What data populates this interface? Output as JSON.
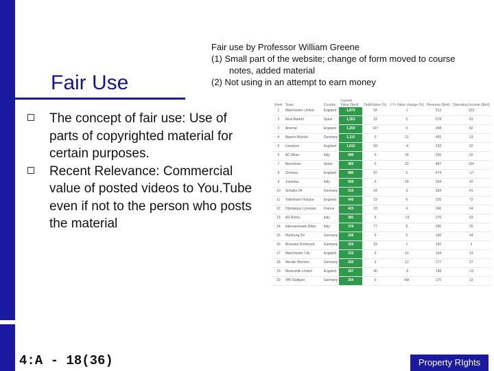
{
  "slide": {
    "title": "Fair Use",
    "note": {
      "line1": "Fair use by Professor William Greene",
      "line2": "(1)  Small part of the website; change of form moved to course",
      "line3": "notes, added material",
      "line4": "(2)  Not using in an attempt to earn money"
    },
    "bullets": [
      "The concept of fair use: Use of parts of copyrighted material for certain purposes.",
      "Recent Relevance: Commercial value of posted videos to You.Tube even if not to the person who posts the material"
    ],
    "footer_id": "4:A - 18(36)",
    "footer_label": "Property RIghts"
  },
  "table": {
    "headers": [
      "Rank",
      "Team",
      "Country",
      "Current Value ($mil)",
      "Debt/Value (%)",
      "1-Yr Value change (%)",
      "Revenue ($mil)",
      "Operating Income ($mil)"
    ],
    "rows": [
      [
        "1",
        "Manchester United",
        "England",
        "1,870",
        "54",
        "-1",
        "512",
        "103"
      ],
      [
        "2",
        "Real Madrid",
        "Spain",
        "1,353",
        "23",
        "5",
        "578",
        "81"
      ],
      [
        "3",
        "Arsenal",
        "England",
        "1,200",
        "107",
        "0",
        "348",
        "82"
      ],
      [
        "4",
        "Bayern Munich",
        "Germany",
        "1,110",
        "0",
        "21",
        "465",
        "53"
      ],
      [
        "5",
        "Liverpool",
        "England",
        "1,010",
        "59",
        "-4",
        "232",
        "52"
      ],
      [
        "6",
        "AC Milan",
        "Italy",
        "990",
        "0",
        "24",
        "330",
        "52"
      ],
      [
        "7",
        "Barcelona",
        "Spain",
        "960",
        "0",
        "22",
        "487",
        "104"
      ],
      [
        "8",
        "Chelsea",
        "England",
        "880",
        "87",
        "5",
        "474",
        "-17"
      ],
      [
        "9",
        "Juventus",
        "Italy",
        "659",
        "0",
        "18",
        "264",
        "42"
      ],
      [
        "10",
        "Schalke 04",
        "Germany",
        "516",
        "34",
        "9",
        "334",
        "41"
      ],
      [
        "11",
        "Tottenham Hotspur",
        "England",
        "445",
        "23",
        "6",
        "220",
        "72"
      ],
      [
        "12",
        "Olympique Lyonnais",
        "France",
        "423",
        "18",
        "4",
        "246",
        "64"
      ],
      [
        "13",
        "AS Roma",
        "Italy",
        "381",
        "6",
        "-12",
        "270",
        "63"
      ],
      [
        "14",
        "Internazionale Milan",
        "Italy",
        "370",
        "77",
        "8",
        "280",
        "25"
      ],
      [
        "15",
        "Hamburg SV",
        "Germany",
        "336",
        "0",
        "0",
        "180",
        "44"
      ],
      [
        "16",
        "Borussia Dortmund",
        "Germany",
        "325",
        "33",
        "1",
        "182",
        "3"
      ],
      [
        "17",
        "Manchester City",
        "England",
        "310",
        "0",
        "12",
        "164",
        "13"
      ],
      [
        "18",
        "Werder Bremen",
        "Germany",
        "292",
        "0",
        "12",
        "177",
        "27"
      ],
      [
        "19",
        "Newcastle United",
        "England",
        "257",
        "90",
        "-9",
        "198",
        "-13"
      ],
      [
        "20",
        "VfB Stuttgart",
        "Germany",
        "254",
        "0",
        "NA",
        "170",
        "13"
      ]
    ]
  },
  "colors": {
    "accent": "#1a1aa0",
    "title": "#14148c",
    "value_column": "#2e9a4a"
  }
}
